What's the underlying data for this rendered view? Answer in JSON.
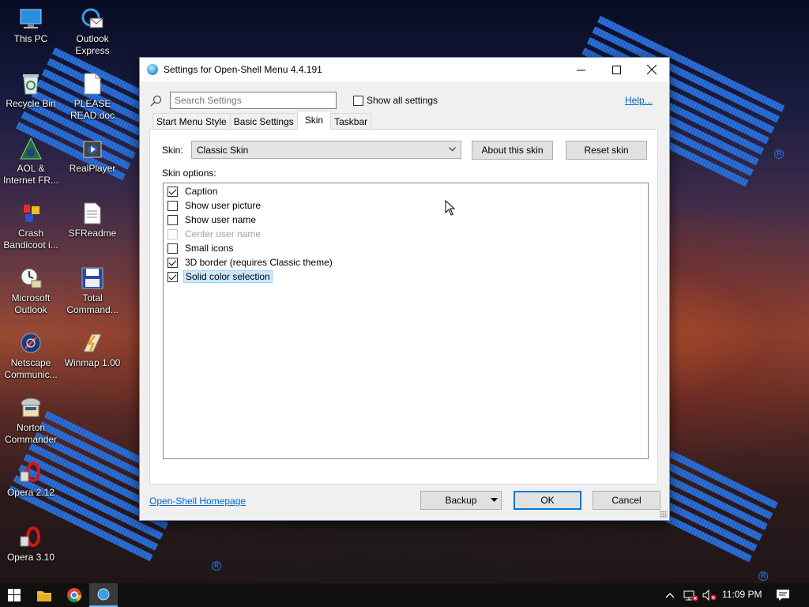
{
  "desktop": {
    "icons": [
      {
        "label": "This PC"
      },
      {
        "label": "Outlook Express"
      },
      {
        "label": "Recycle Bin"
      },
      {
        "label": "PLEASE READ.doc"
      },
      {
        "label": "AOL & Internet FR..."
      },
      {
        "label": "RealPlayer"
      },
      {
        "label": "Crash Bandicoot i..."
      },
      {
        "label": "SFReadme"
      },
      {
        "label": "Microsoft Outlook"
      },
      {
        "label": "Total Command..."
      },
      {
        "label": "Netscape Communic..."
      },
      {
        "label": "Winmap 1.00"
      },
      {
        "label": "Norton Commander"
      },
      {
        "label": "Opera 2.12"
      },
      {
        "label": "Opera 3.10"
      }
    ]
  },
  "window": {
    "title": "Settings for Open-Shell Menu 4.4.191",
    "controls": {
      "minimize": "—",
      "maximize": "☐",
      "close": "✕"
    }
  },
  "search": {
    "placeholder": "Search Settings"
  },
  "show_all": {
    "label": "Show all settings",
    "checked": false
  },
  "help_link": "Help...",
  "tabs": [
    {
      "label": "Start Menu Style",
      "active": false
    },
    {
      "label": "Basic Settings",
      "active": false
    },
    {
      "label": "Skin",
      "active": true
    },
    {
      "label": "Taskbar",
      "active": false
    }
  ],
  "skin": {
    "label": "Skin:",
    "selected": "Classic Skin",
    "about_button": "About this skin",
    "reset_button": "Reset skin",
    "options_label": "Skin options:",
    "options": [
      {
        "label": "Caption",
        "checked": true,
        "disabled": false,
        "selected": false
      },
      {
        "label": "Show user picture",
        "checked": false,
        "disabled": false,
        "selected": false
      },
      {
        "label": "Show user name",
        "checked": false,
        "disabled": false,
        "selected": false
      },
      {
        "label": "Center user name",
        "checked": false,
        "disabled": true,
        "selected": false
      },
      {
        "label": "Small icons",
        "checked": false,
        "disabled": false,
        "selected": false
      },
      {
        "label": "3D border (requires Classic theme)",
        "checked": true,
        "disabled": false,
        "selected": false
      },
      {
        "label": "Solid color selection",
        "checked": true,
        "disabled": false,
        "selected": true
      }
    ]
  },
  "footer": {
    "homepage_link": "Open-Shell Homepage",
    "backup_button": "Backup",
    "ok_button": "OK",
    "cancel_button": "Cancel"
  },
  "taskbar": {
    "time": "11:09 PM"
  },
  "colors": {
    "accent": "#0078d7",
    "link": "#0066cc",
    "selection": "#cce8ff"
  }
}
